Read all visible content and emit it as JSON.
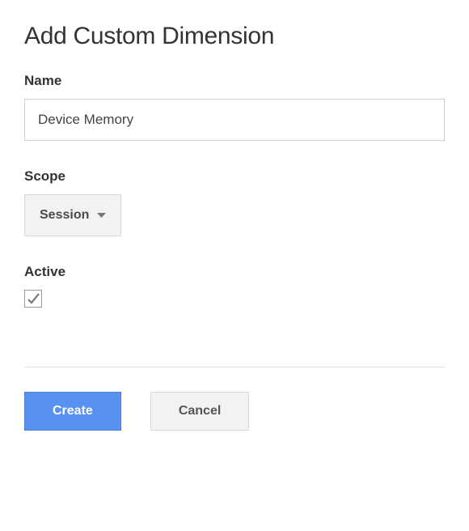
{
  "title": "Add Custom Dimension",
  "fields": {
    "name": {
      "label": "Name",
      "value": "Device Memory"
    },
    "scope": {
      "label": "Scope",
      "selected": "Session"
    },
    "active": {
      "label": "Active",
      "checked": true
    }
  },
  "buttons": {
    "create": "Create",
    "cancel": "Cancel"
  }
}
